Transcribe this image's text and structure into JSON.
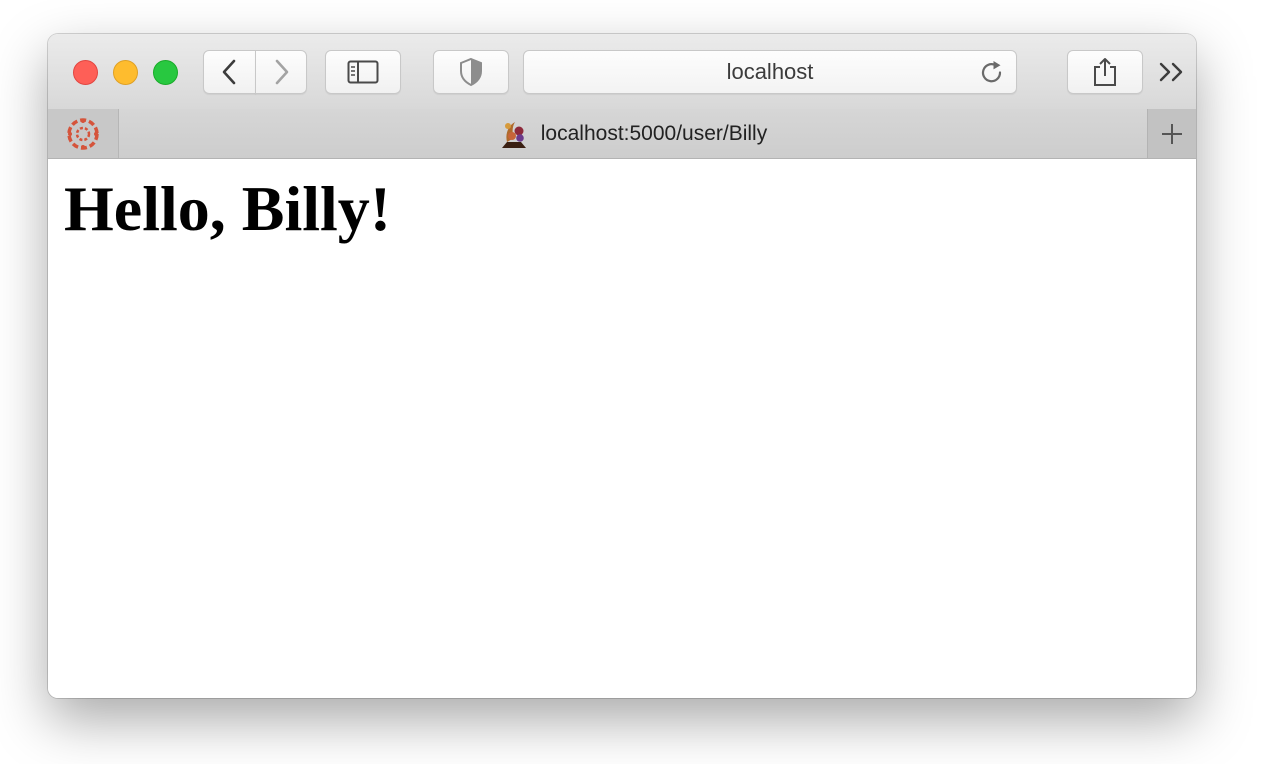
{
  "toolbar": {
    "address_text": "localhost"
  },
  "tabs": {
    "active_title": "localhost:5000/user/Billy"
  },
  "page": {
    "heading": "Hello, Billy!"
  },
  "icons": {
    "close": "close-icon",
    "minimize": "minimize-icon",
    "maximize": "maximize-icon",
    "back": "chevron-left-icon",
    "forward": "chevron-right-icon",
    "sidebar": "sidebar-icon",
    "privacy": "shield-icon",
    "reload": "reload-icon",
    "share": "share-icon",
    "overflow": "double-chevron-right-icon",
    "pinned_tab": "canvas-logo-icon",
    "tab_favicon": "cornucopia-favicon-icon",
    "new_tab": "plus-icon"
  },
  "colors": {
    "close": "#fe5f57",
    "minimize": "#febc2e",
    "maximize": "#28c840",
    "pinned_logo": "#d5543b"
  }
}
